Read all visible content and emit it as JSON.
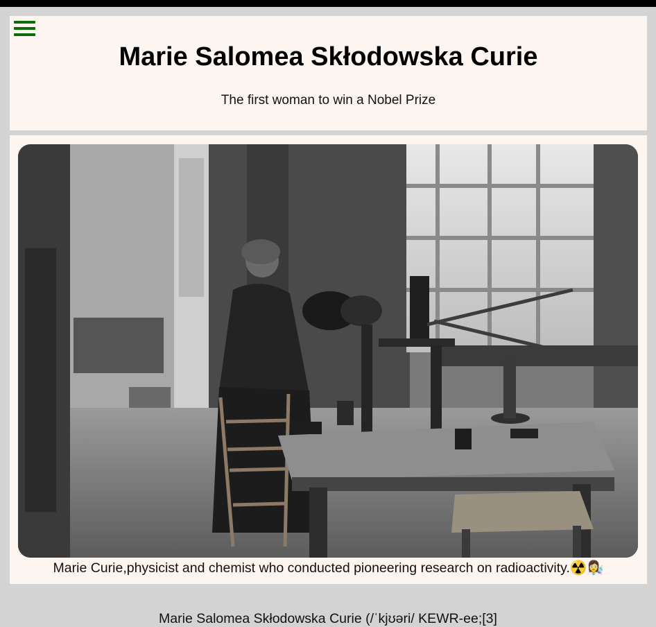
{
  "header": {
    "title": "Marie Salomea Skłodowska Curie",
    "subtitle": "The first woman to win a Nobel Prize"
  },
  "figure": {
    "caption": "Marie Curie,physicist and chemist who conducted pioneering research on radioactivity.☢️👩‍🔬"
  },
  "article": {
    "intro_fragment": "Marie Salomea Skłodowska Curie (/ˈkjʊəri/ KEWR-ee;[3]"
  },
  "colors": {
    "menu_icon": "#0a6b0a",
    "card_background": "#fdf5ef",
    "page_background": "#d3d3d3"
  }
}
